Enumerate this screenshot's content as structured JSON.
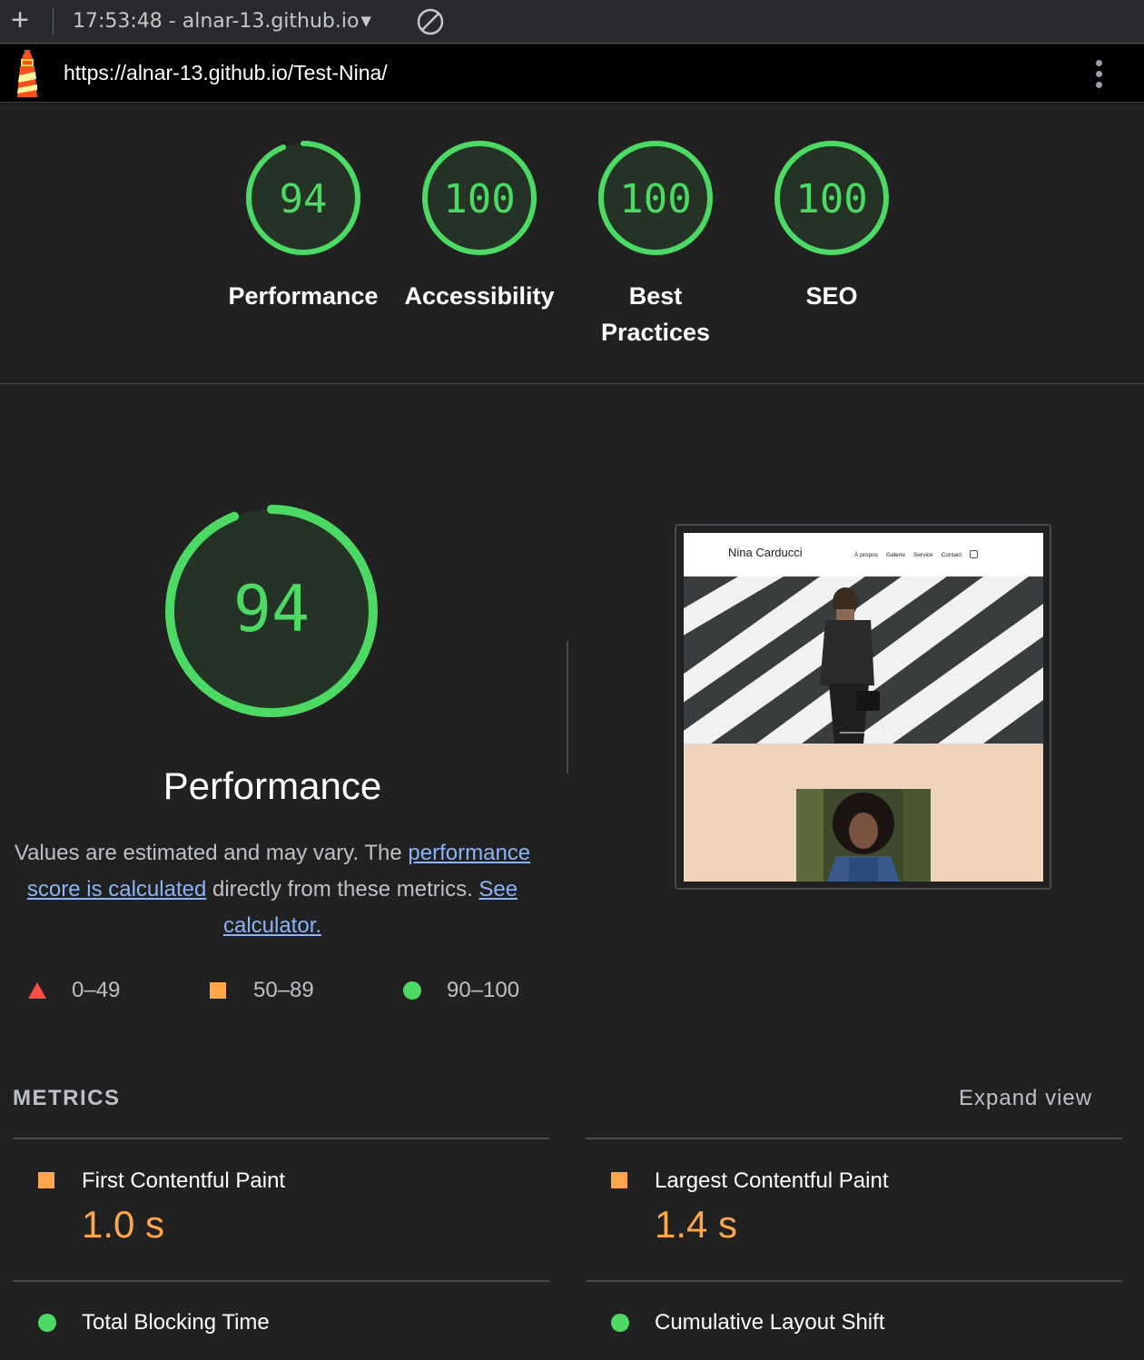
{
  "toolbar": {
    "report_label": "17:53:48 - alnar-13.github.io"
  },
  "urlbar": {
    "url": "https://alnar-13.github.io/Test-Nina/"
  },
  "categories": [
    {
      "score": "94",
      "label": "Performance"
    },
    {
      "score": "100",
      "label": "Accessibility"
    },
    {
      "score": "100",
      "label": "Best Practices"
    },
    {
      "score": "100",
      "label": "SEO"
    }
  ],
  "performance": {
    "score": "94",
    "title": "Performance",
    "desc_1": "Values are estimated and may vary. The ",
    "link_1": "performance score is calculated",
    "desc_2": " directly from these metrics. ",
    "link_2": "See calculator."
  },
  "legend": {
    "fail": "0–49",
    "average": "50–89",
    "pass": "90–100"
  },
  "screenshot": {
    "site_name": "Nina Carducci",
    "nav": [
      "À propos",
      "Galerie",
      "Service",
      "Contact"
    ]
  },
  "metrics": {
    "title": "METRICS",
    "expand": "Expand view",
    "items": [
      {
        "label": "First Contentful Paint",
        "value": "1.0 s",
        "rating": "average"
      },
      {
        "label": "Largest Contentful Paint",
        "value": "1.4 s",
        "rating": "average"
      },
      {
        "label": "Total Blocking Time",
        "value": "",
        "rating": "pass"
      },
      {
        "label": "Cumulative Layout Shift",
        "value": "",
        "rating": "pass"
      }
    ]
  },
  "colors": {
    "pass": "#4cd964",
    "average": "#ffa64d",
    "fail": "#ff4e42",
    "background": "#212121",
    "link": "#8ab4f8"
  }
}
